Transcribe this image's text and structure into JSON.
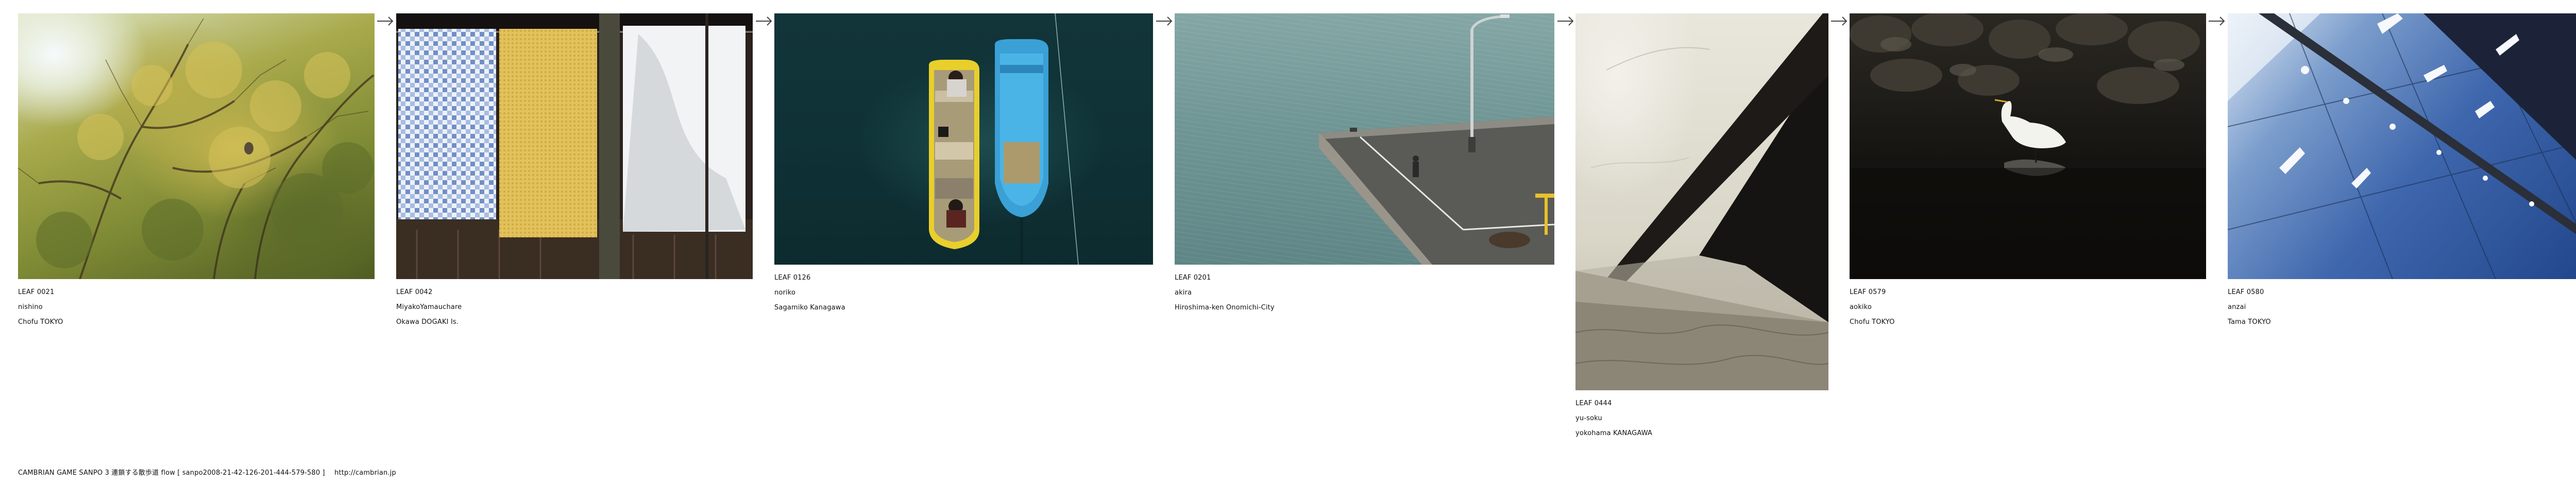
{
  "leaves": [
    {
      "leaf": "LEAF 0021",
      "user": "nishino",
      "place": "Chofu TOKYO"
    },
    {
      "leaf": "LEAF 0042",
      "user": "MiyakoYamauchare",
      "place": "Okawa DOGAKI Is."
    },
    {
      "leaf": "LEAF 0126",
      "user": "noriko",
      "place": "Sagamiko Kanagawa"
    },
    {
      "leaf": "LEAF 0201",
      "user": "akira",
      "place": "Hiroshima-ken Onomichi-City"
    },
    {
      "leaf": "LEAF 0444",
      "user": "yu-soku",
      "place": "yokohama KANAGAWA"
    },
    {
      "leaf": "LEAF 0579",
      "user": "aokiko",
      "place": "Chofu TOKYO"
    },
    {
      "leaf": "LEAF 0580",
      "user": "anzai",
      "place": "Tama TOKYO"
    }
  ],
  "footer": {
    "text": "CAMBRIAN GAME  SANPO 3 連鎖する散歩道 flow [ sanpo2008-21-42-126-201-444-579-580 ]",
    "link": "http://cambrian.jp"
  },
  "colors": {
    "text": "#111111",
    "background": "#ffffff"
  }
}
